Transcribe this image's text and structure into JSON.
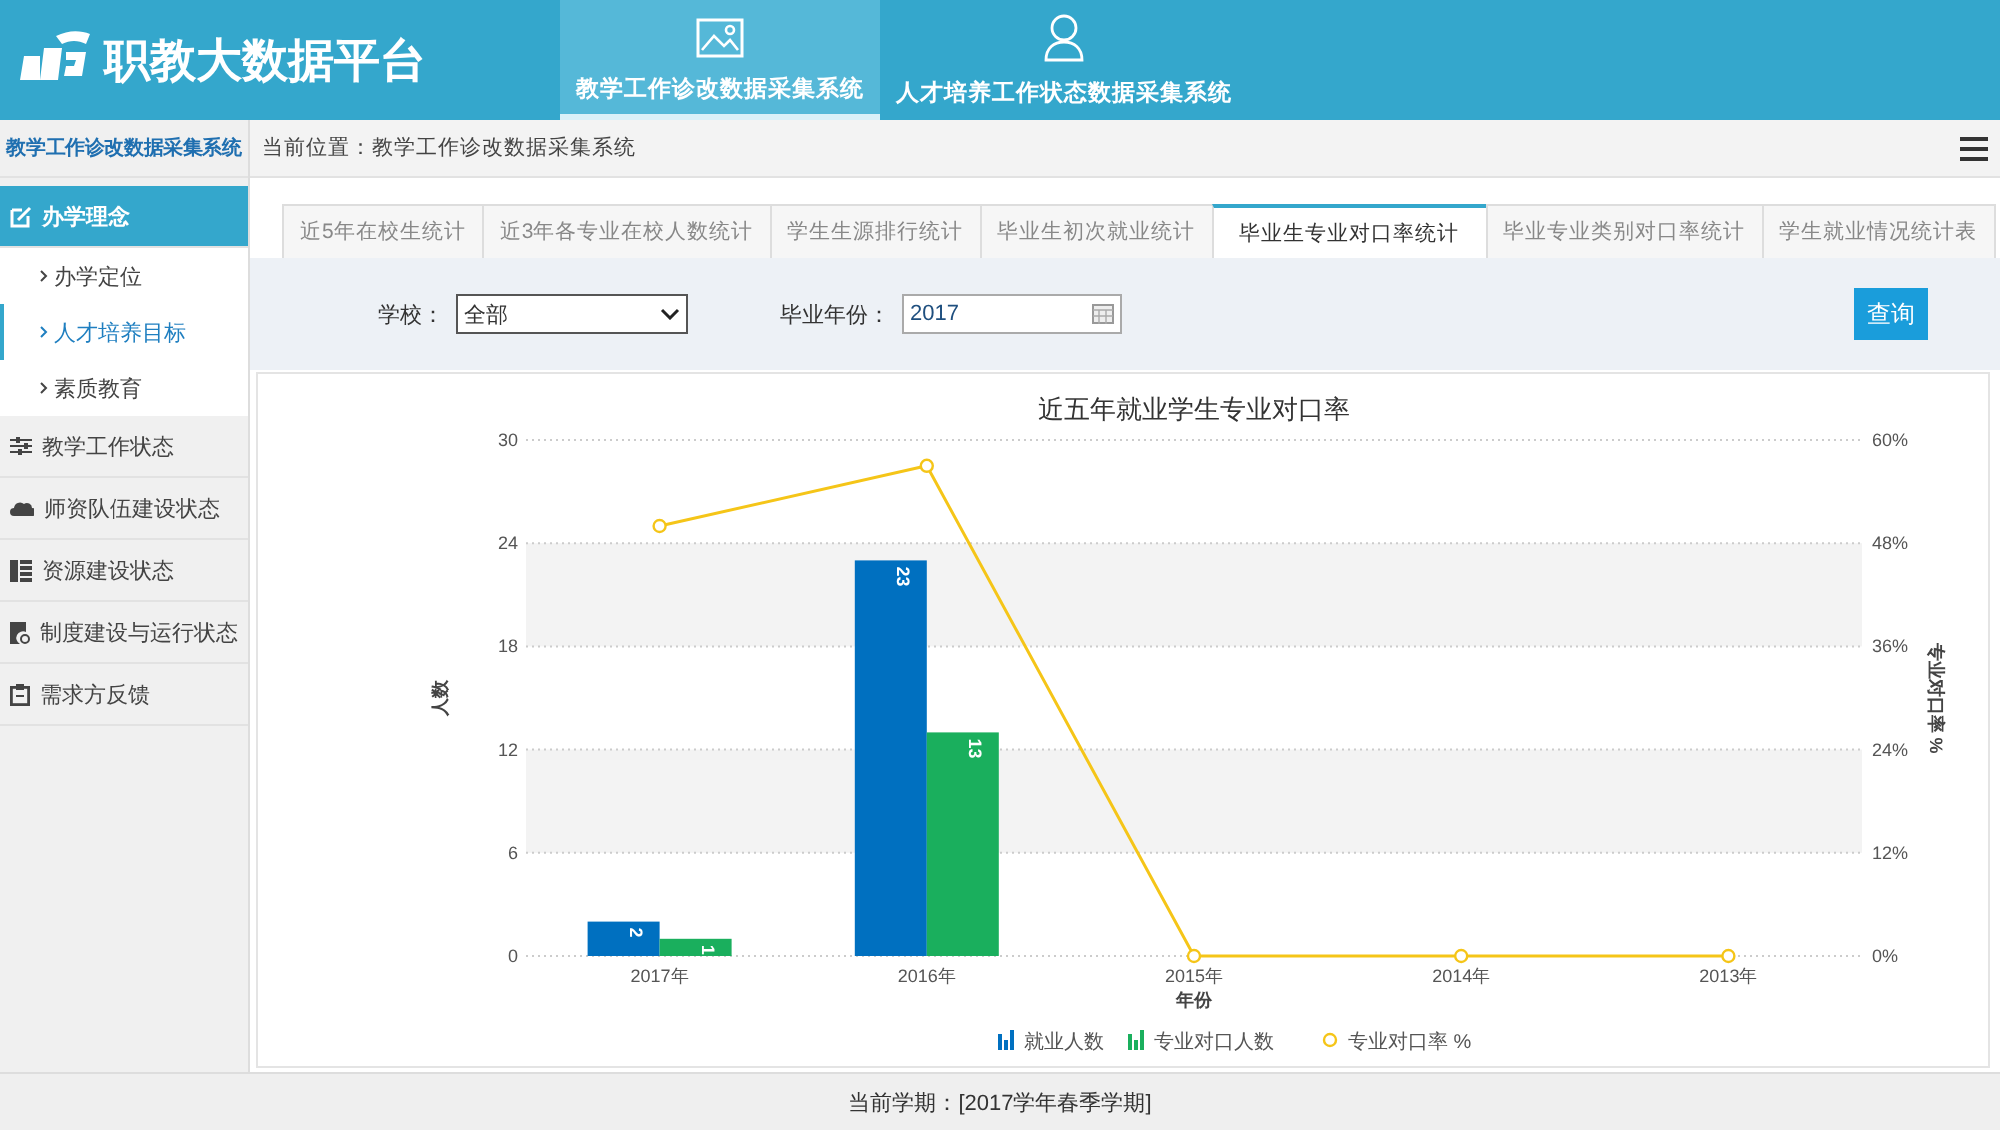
{
  "header": {
    "title": "职教大数据平台",
    "nav": [
      {
        "label": "教学工作诊改数据采集系统",
        "selected": true
      },
      {
        "label": "人才培养工作状态数据采集系统",
        "selected": false
      }
    ]
  },
  "sidebar": {
    "title": "教学工作诊改数据采集系统",
    "items": [
      {
        "label": "办学理念",
        "selected": true,
        "expanded": true,
        "children": [
          {
            "label": "办学定位",
            "selected": false
          },
          {
            "label": "人才培养目标",
            "selected": true
          },
          {
            "label": "素质教育",
            "selected": false
          }
        ]
      },
      {
        "label": "教学工作状态",
        "selected": false
      },
      {
        "label": "师资队伍建设状态",
        "selected": false
      },
      {
        "label": "资源建设状态",
        "selected": false
      },
      {
        "label": "制度建设与运行状态",
        "selected": false
      },
      {
        "label": "需求方反馈",
        "selected": false
      }
    ]
  },
  "breadcrumb": "当前位置：教学工作诊改数据采集系统",
  "tabs": [
    {
      "label": "近5年在校生统计",
      "selected": false
    },
    {
      "label": "近3年各专业在校人数统计",
      "selected": false
    },
    {
      "label": "学生生源排行统计",
      "selected": false
    },
    {
      "label": "毕业生初次就业统计",
      "selected": false
    },
    {
      "label": "毕业生专业对口率统计",
      "selected": true
    },
    {
      "label": "毕业专业类别对口率统计",
      "selected": false
    },
    {
      "label": "学生就业情况统计表",
      "selected": false
    }
  ],
  "filters": {
    "school_label": "学校：",
    "school_value": "全部",
    "year_label": "毕业年份：",
    "year_value": "2017",
    "query_button": "查询"
  },
  "count_chart": {
    "chart_data": {
      "type": "bar",
      "title": "近五年就业学生专业对口率",
      "xlabel": "年份",
      "ylabel": "人数",
      "categories": [
        "2017年",
        "2016年",
        "2015年",
        "2014年",
        "2013年"
      ],
      "series": [
        {
          "name": "就业人数",
          "color": "#0070c0",
          "values": [
            2,
            23,
            0,
            0,
            0
          ],
          "value_labels": [
            "2",
            "23",
            null,
            null,
            null
          ]
        },
        {
          "name": "专业对口人数",
          "color": "#1aaf5d",
          "values": [
            1,
            13,
            0,
            0,
            0
          ],
          "value_labels": [
            "1",
            "13",
            null,
            null,
            null
          ]
        }
      ],
      "grid": true,
      "legend": true,
      "ylim": [
        0,
        30
      ],
      "yticks": [
        0,
        6,
        12,
        18,
        24,
        30
      ]
    }
  },
  "rate_chart": {
    "chart_data": {
      "type": "line",
      "ylabel": "专业对口率 %",
      "series": [
        {
          "name": "专业对口率 %",
          "color": "#f5c518",
          "marker": "circle",
          "values": [
            50,
            57,
            0,
            0,
            0
          ]
        }
      ],
      "legend": true,
      "ylim": [
        0,
        60
      ],
      "yticks": [
        {
          "value": 0,
          "label": "0%"
        },
        {
          "value": 12,
          "label": "12%"
        },
        {
          "value": 24,
          "label": "24%"
        },
        {
          "value": 36,
          "label": "36%"
        },
        {
          "value": 48,
          "label": "48%"
        },
        {
          "value": 60,
          "label": "60%"
        }
      ]
    }
  },
  "footer": "当前学期：[2017学年春季学期]"
}
